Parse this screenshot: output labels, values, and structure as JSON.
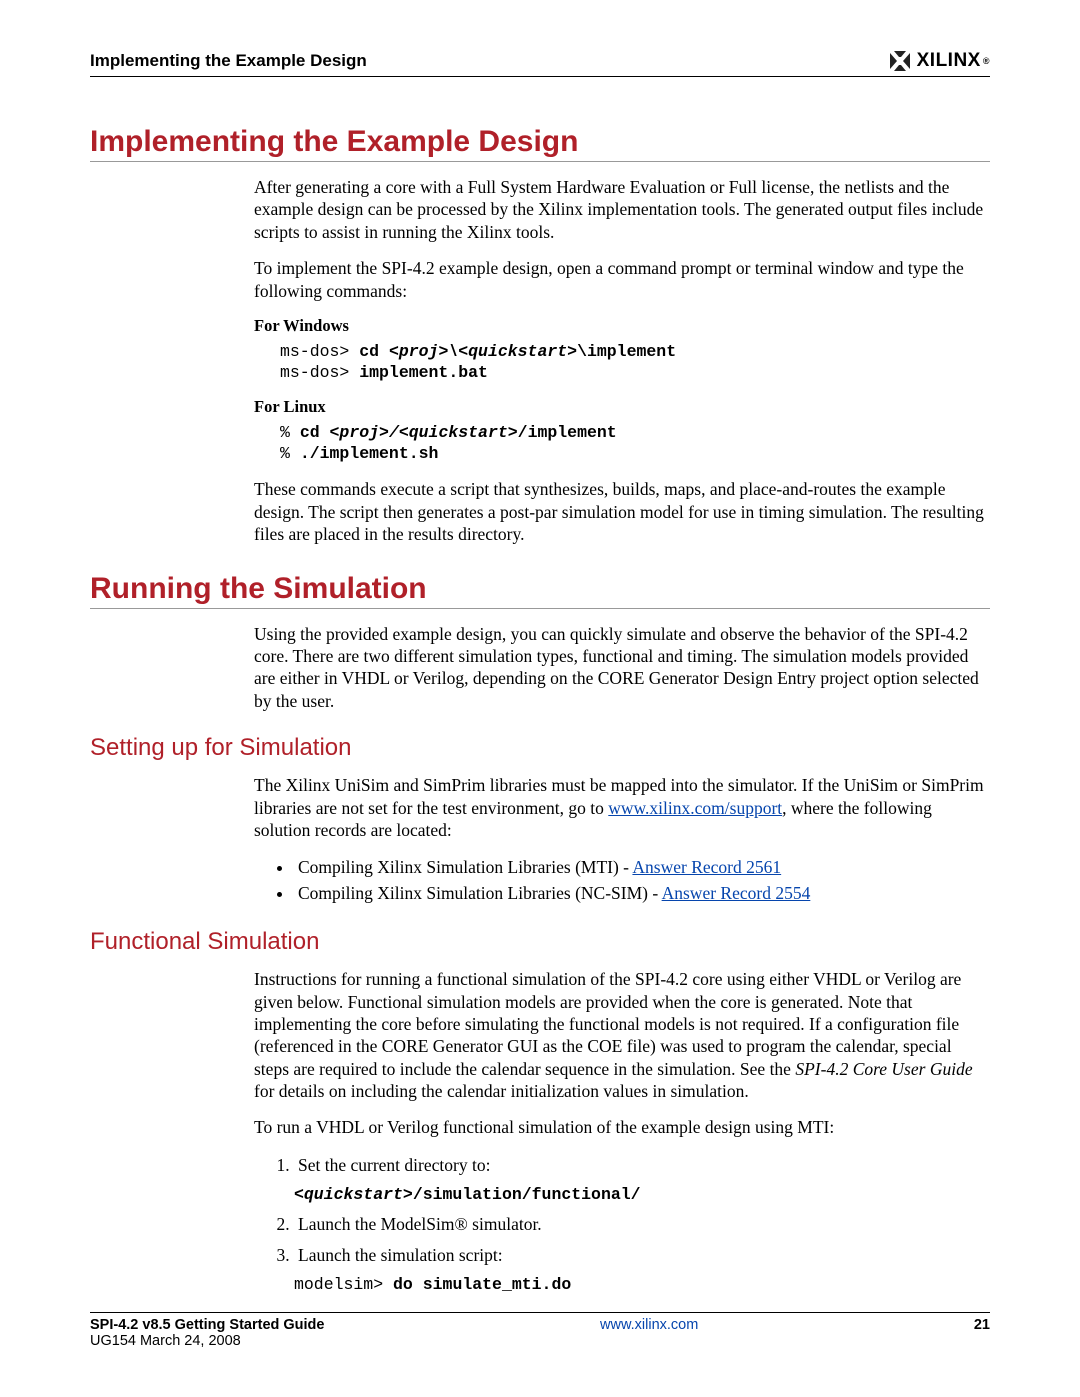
{
  "header": {
    "running_title": "Implementing the Example Design",
    "logo_text": "XILINX",
    "logo_reg": "®"
  },
  "sections": {
    "implementing": {
      "title": "Implementing the Example Design",
      "p1": "After generating a core with a Full System Hardware Evaluation or Full license, the netlists and the example design can be processed by the Xilinx implementation tools. The generated output files include scripts to assist in running the Xilinx tools.",
      "p2": "To implement the SPI-4.2 example design, open a command prompt or terminal window and type the following commands:",
      "windows_label": "For Windows",
      "windows_code_l1a": "ms-dos> ",
      "windows_code_l1b": "cd ",
      "windows_code_l1c": "<proj>\\<quickstart>",
      "windows_code_l1d": "\\implement",
      "windows_code_l2a": "ms-dos> ",
      "windows_code_l2b": "implement.bat",
      "linux_label": "For Linux",
      "linux_code_l1a": "% ",
      "linux_code_l1b": "cd ",
      "linux_code_l1c": "<proj>/<quickstart>",
      "linux_code_l1d": "/implement",
      "linux_code_l2a": "% ",
      "linux_code_l2b": "./implement.sh",
      "p3": "These commands execute a script that synthesizes, builds, maps, and place-and-routes the example design. The script then generates a post-par simulation model for use in timing simulation. The resulting files are placed in the results directory."
    },
    "running": {
      "title": "Running the Simulation",
      "p1": "Using the provided example design, you can quickly simulate and observe the behavior of the SPI-4.2 core. There are two different simulation types, functional and timing. The simulation models provided are either in VHDL or Verilog, depending on the CORE Generator Design Entry project option selected by the user.",
      "setup": {
        "title": "Setting up for Simulation",
        "p1a": "The Xilinx UniSim and SimPrim libraries must be mapped into the simulator. If the UniSim or SimPrim libraries are not set for the test environment, go to ",
        "link1_text": "www.xilinx.com/support",
        "p1b": ", where the following solution records are located:",
        "bullet1a": "Compiling Xilinx Simulation Libraries (MTI) - ",
        "bullet1_link": "Answer Record 2561",
        "bullet2a": "Compiling Xilinx Simulation Libraries (NC-SIM) - ",
        "bullet2_link": "Answer Record 2554"
      },
      "functional": {
        "title": "Functional Simulation",
        "p1a": "Instructions for running a functional simulation of the SPI-4.2 core using either VHDL or Verilog are given below. Functional simulation models are provided when the core is generated. Note that implementing the core before simulating the functional models is not required. If a configuration file (referenced in the CORE Generator GUI as the COE file) was used to program the calendar, special steps are required to include the calendar sequence in the simulation. See the ",
        "p1_ref": "SPI-4.2 Core User Guide",
        "p1b": " for details on including the calendar initialization values in simulation.",
        "p2": "To run a VHDL or Verilog functional simulation of the example design using MTI:",
        "step1": "Set the current directory to:",
        "step1_code_a": "<quickstart>",
        "step1_code_b": "/simulation/functional/",
        "step2": "Launch the ModelSim® simulator.",
        "step3": "Launch the simulation script:",
        "step3_code_a": "modelsim> ",
        "step3_code_b": "do simulate_mti.do"
      }
    }
  },
  "footer": {
    "doc_title": "SPI-4.2 v8.5 Getting Started Guide",
    "doc_date": "UG154 March 24, 2008",
    "url": "www.xilinx.com",
    "page_num": "21"
  }
}
